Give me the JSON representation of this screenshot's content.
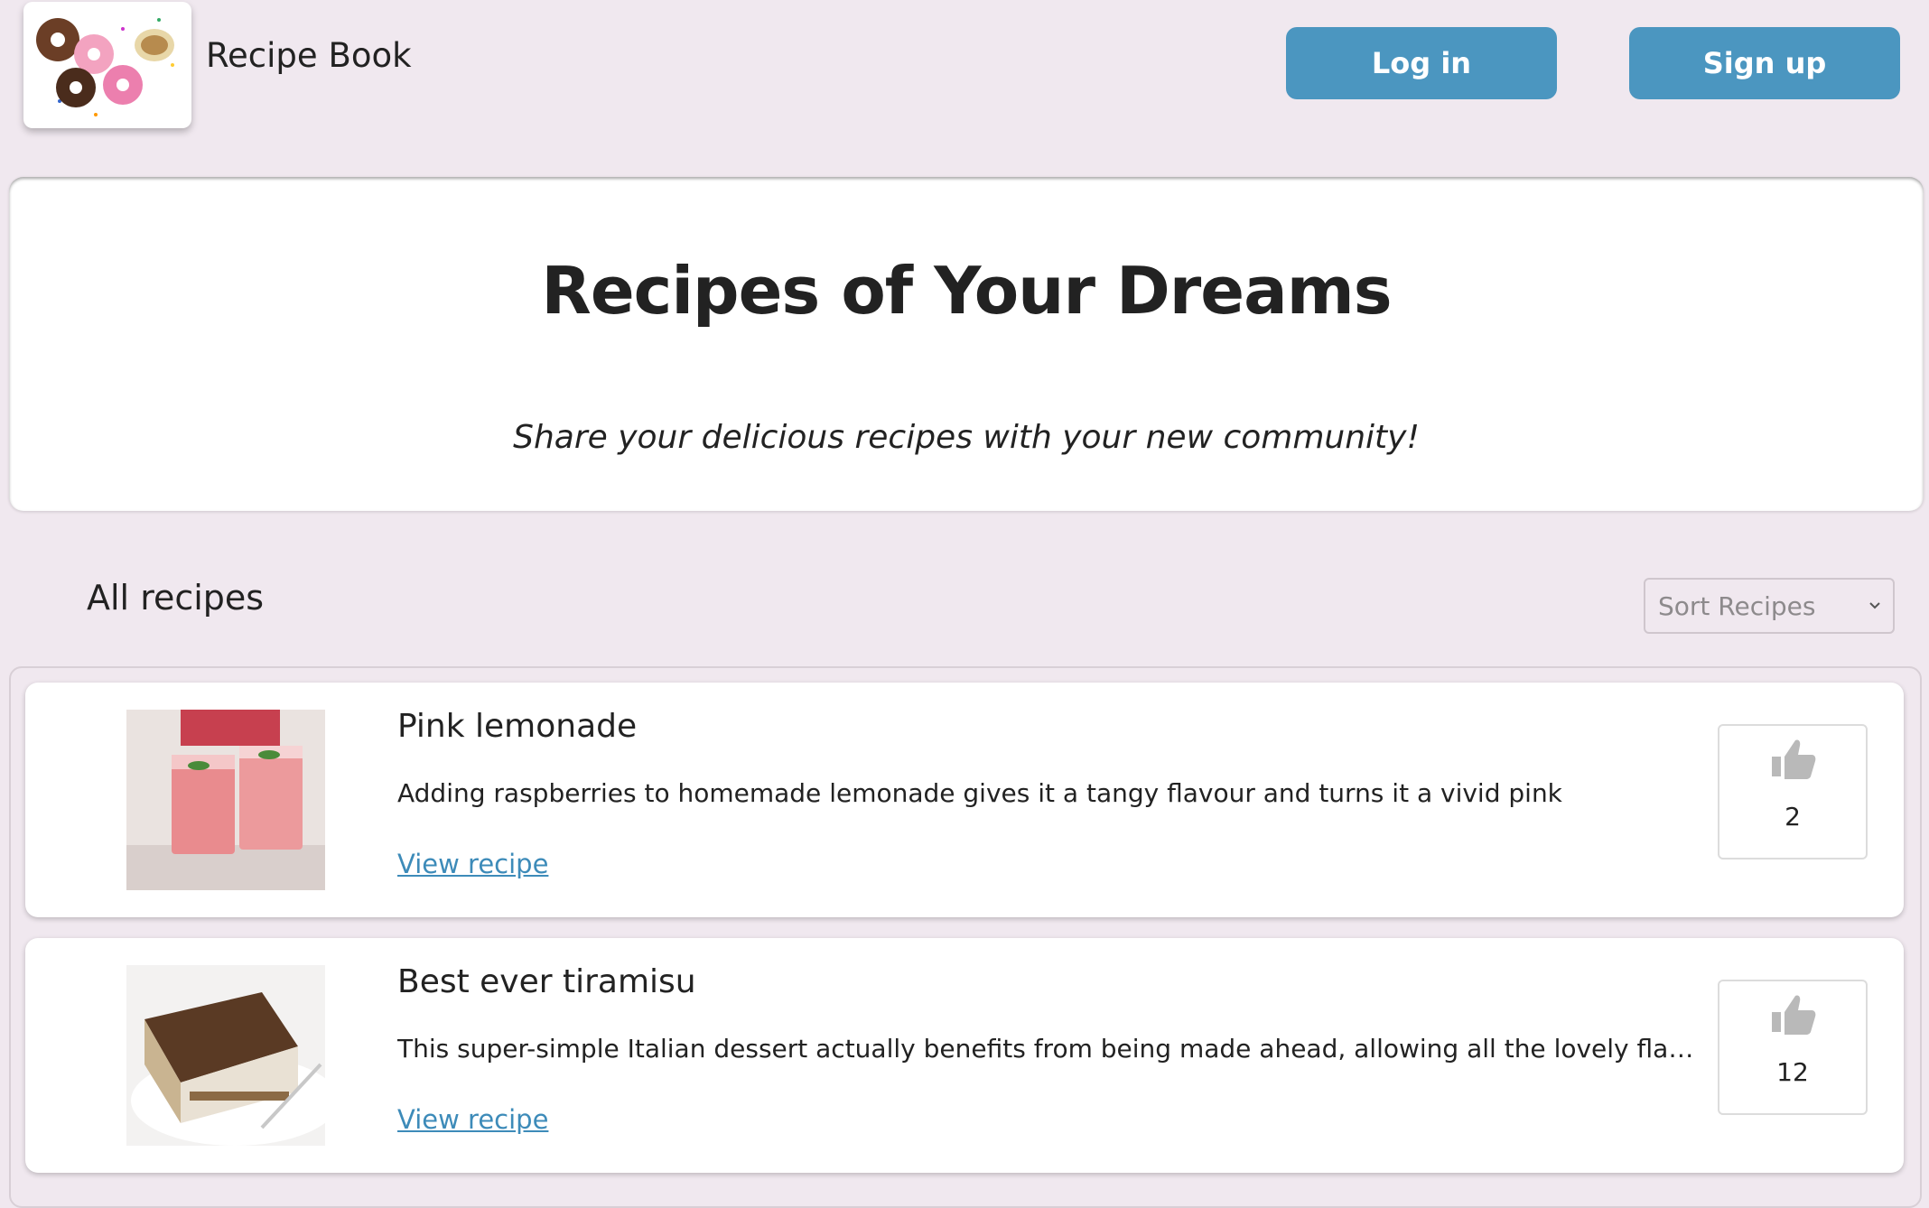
{
  "header": {
    "brand": "Recipe Book",
    "login_label": "Log in",
    "signup_label": "Sign up"
  },
  "hero": {
    "title": "Recipes of Your Dreams",
    "subtitle": "Share your delicious recipes with your new community!"
  },
  "recipes_section": {
    "title": "All recipes",
    "sort_placeholder": "Sort Recipes"
  },
  "recipes": [
    {
      "title": "Pink lemonade",
      "description": "Adding raspberries to homemade lemonade gives it a tangy flavour and turns it a vivid pink",
      "link": "View recipe",
      "likes": "2"
    },
    {
      "title": "Best ever tiramisu",
      "description": "This super-simple Italian dessert actually benefits from being made ahead, allowing all the lovely flavours to...",
      "link": "View recipe",
      "likes": "12"
    }
  ],
  "colors": {
    "background": "#f0e8ef",
    "button": "#4b96c0",
    "link": "#3d8bb9"
  },
  "icons": {
    "logo": "donuts-logo",
    "like": "thumbs-up-icon",
    "sort": "chevron-down-icon"
  }
}
